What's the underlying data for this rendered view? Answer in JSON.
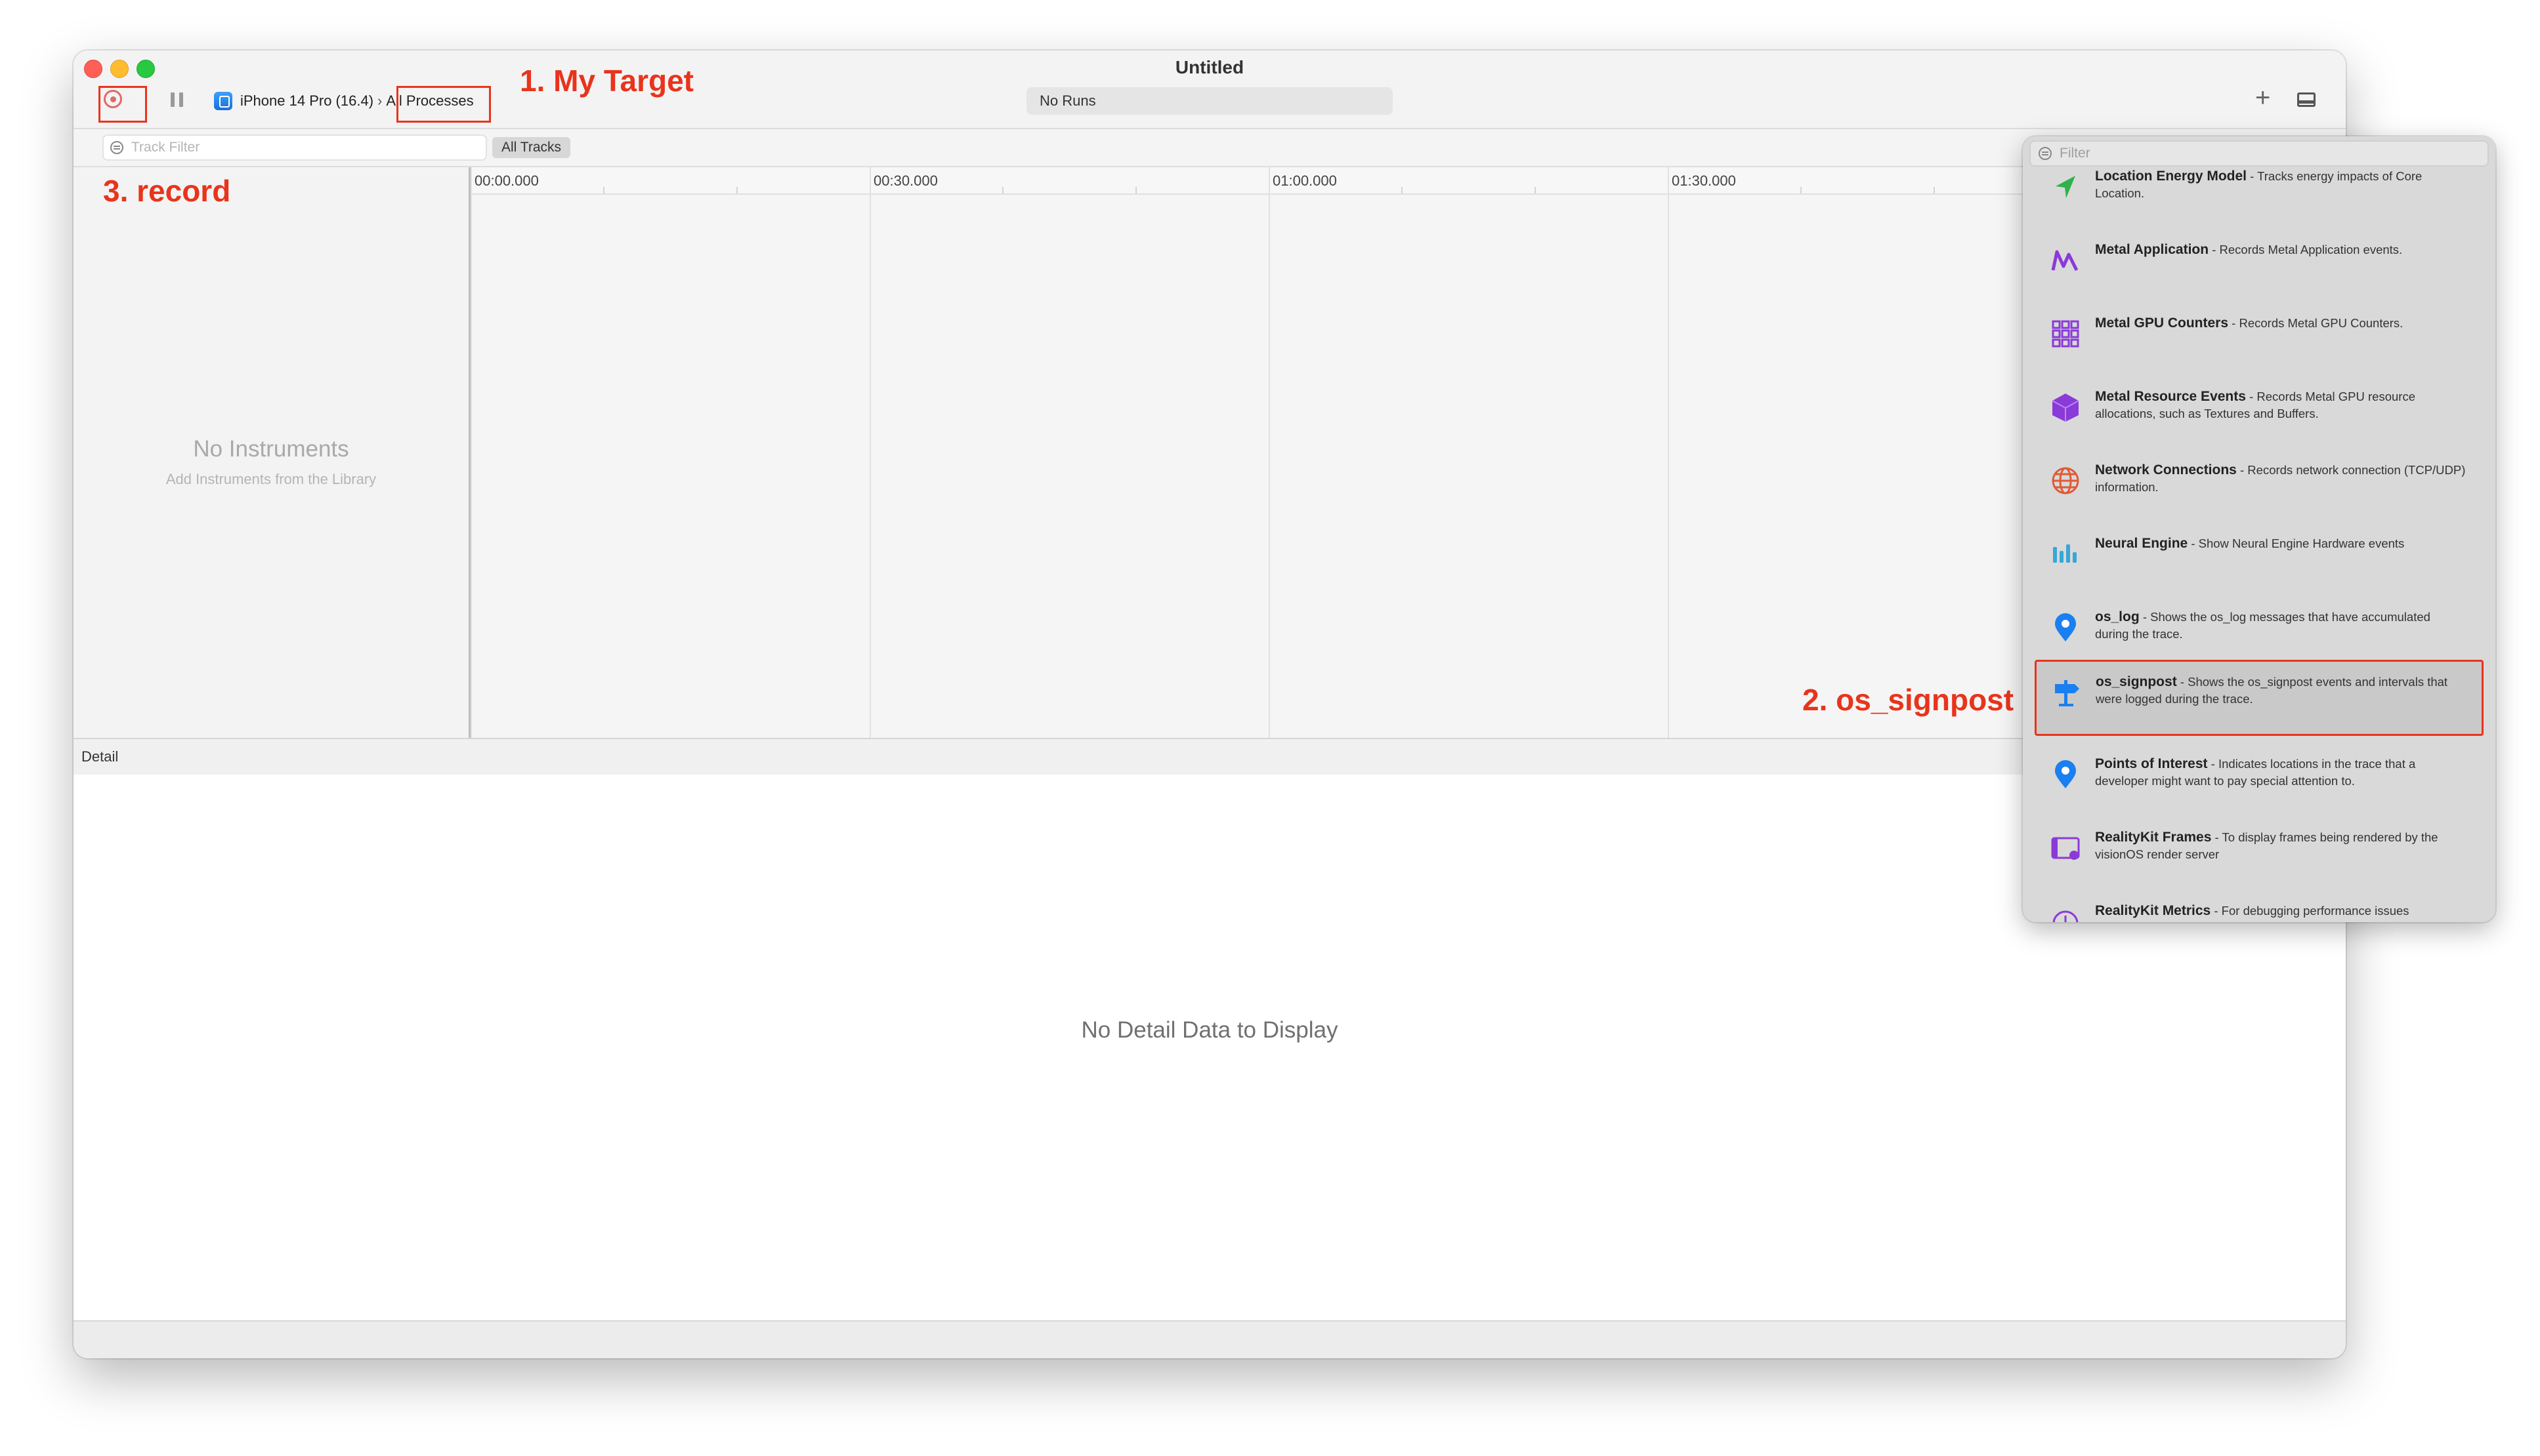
{
  "window": {
    "title": "Untitled"
  },
  "toolbar": {
    "device": "iPhone 14 Pro (16.4)",
    "target": "All Processes",
    "status": "No Runs"
  },
  "filterbar": {
    "track_filter_placeholder": "Track Filter",
    "all_tracks": "All Tracks"
  },
  "sidebar": {
    "empty_title": "No Instruments",
    "empty_subtitle": "Add Instruments from the Library"
  },
  "timeline": {
    "ticks": [
      "00:00.000",
      "00:30.000",
      "01:00.000",
      "01:30.000"
    ]
  },
  "detail": {
    "label": "Detail",
    "empty": "No Detail Data to Display"
  },
  "annotations": {
    "target": "1. My Target",
    "signpost": "2. os_signpost",
    "record": "3. record"
  },
  "library": {
    "filter_placeholder": "Filter",
    "items": [
      {
        "name": "Location Energy Model",
        "desc": " - Tracks energy impacts of Core Location.",
        "icon": "location-arrow-icon",
        "color": "#2fb24a"
      },
      {
        "name": "Metal Application",
        "desc": " - Records Metal Application events.",
        "icon": "metal-icon",
        "color": "#8a3ad8"
      },
      {
        "name": "Metal GPU Counters",
        "desc": " - Records Metal GPU Counters.",
        "icon": "grid-icon",
        "color": "#8a3ad8"
      },
      {
        "name": "Metal Resource Events",
        "desc": " - Records Metal GPU resource allocations, such as Textures and Buffers.",
        "icon": "cube-icon",
        "color": "#8a3ad8"
      },
      {
        "name": "Network Connections",
        "desc": " - Records network connection (TCP/UDP) information.",
        "icon": "globe-icon",
        "color": "#e05a38"
      },
      {
        "name": "Neural Engine",
        "desc": " - Show Neural Engine Hardware events",
        "icon": "waveform-icon",
        "color": "#36a7d8"
      },
      {
        "name": "os_log",
        "desc": " - Shows the os_log messages that have accumulated during the trace.",
        "icon": "pin-icon",
        "color": "#1a7ff0"
      },
      {
        "name": "os_signpost",
        "desc": " - Shows the os_signpost events and intervals that were logged during the trace.",
        "icon": "signpost-icon",
        "color": "#1a7ff0"
      },
      {
        "name": "Points of Interest",
        "desc": " - Indicates locations in the trace that a developer might want to pay special attention to.",
        "icon": "pin-icon",
        "color": "#1a7ff0"
      },
      {
        "name": "RealityKit Frames",
        "desc": " - To display frames being rendered by the visionOS render server",
        "icon": "film-icon",
        "color": "#8a3ad8"
      },
      {
        "name": "RealityKit Metrics",
        "desc": " - For debugging performance issues",
        "icon": "gauge-icon",
        "color": "#8a3ad8"
      }
    ]
  }
}
